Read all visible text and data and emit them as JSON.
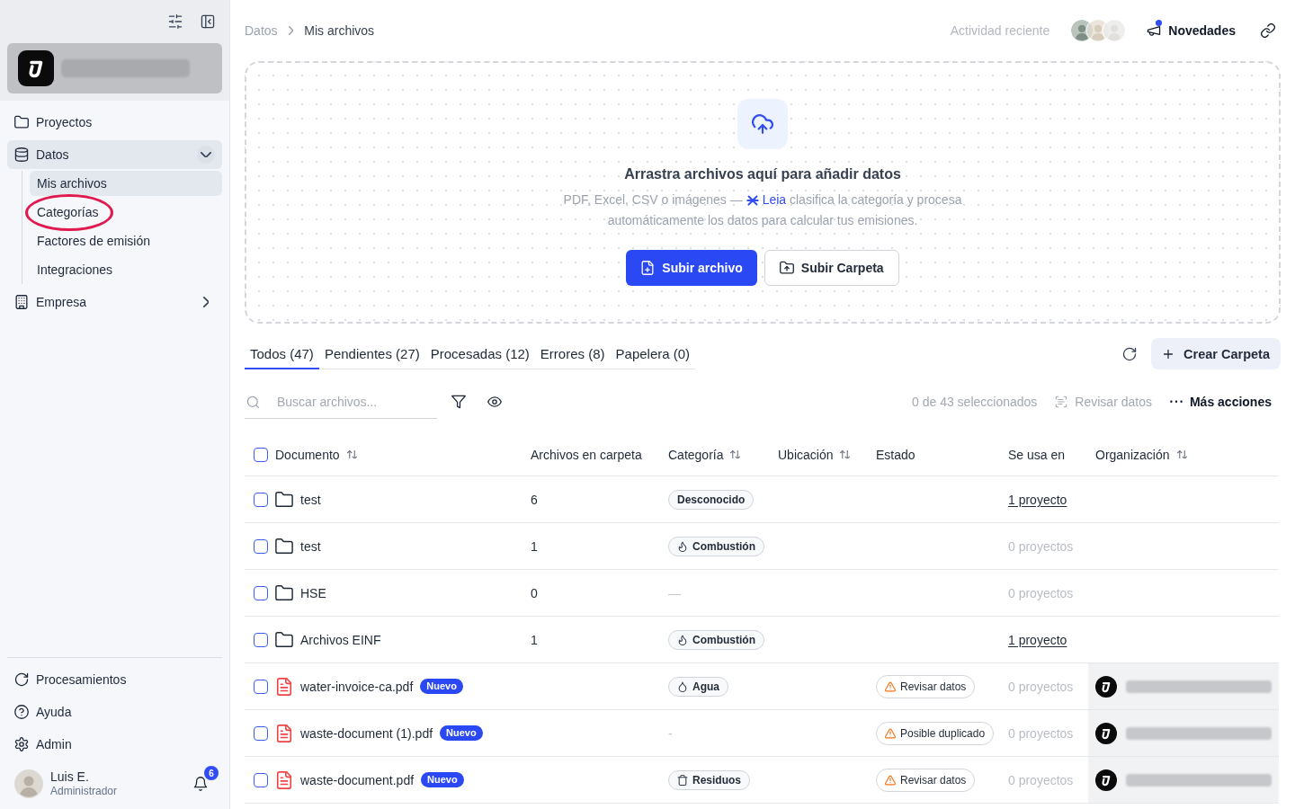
{
  "sidebar": {
    "nav": [
      {
        "label": "Proyectos",
        "kind": "link",
        "selected": false
      },
      {
        "label": "Datos",
        "kind": "group",
        "selected": true,
        "expanded": true,
        "children": [
          {
            "label": "Mis archivos",
            "selected": true,
            "circled": false
          },
          {
            "label": "Categorías",
            "selected": false,
            "circled": true
          },
          {
            "label": "Factores de emisión",
            "selected": false,
            "circled": false
          },
          {
            "label": "Integraciones",
            "selected": false,
            "circled": false
          }
        ]
      },
      {
        "label": "Empresa",
        "kind": "group",
        "selected": false,
        "expanded": false
      }
    ],
    "footer_nav": [
      {
        "label": "Procesamientos"
      },
      {
        "label": "Ayuda"
      },
      {
        "label": "Admin"
      }
    ],
    "user": {
      "name": "Luis E.",
      "role": "Administrador",
      "notifications": "6"
    }
  },
  "topbar": {
    "breadcrumb": [
      "Datos",
      "Mis archivos"
    ],
    "activity": "Actividad reciente",
    "news": {
      "label": "Novedades",
      "unread": true
    }
  },
  "upload": {
    "title": "Arrastra archivos aquí para añadir datos",
    "description_start": "PDF, Excel, CSV o imágenes —",
    "assistant": "Leia",
    "description_end": "clasifica la categoría y procesa automáticamente los datos para calcular tus emisiones.",
    "buttons": [
      {
        "label": "Subir archivo",
        "primary": true
      },
      {
        "label": "Subir Carpeta",
        "primary": false
      }
    ]
  },
  "tabs": [
    {
      "label": "Todos (47)",
      "selected": true
    },
    {
      "label": "Pendientes (27)",
      "selected": false
    },
    {
      "label": "Procesadas (12)",
      "selected": false
    },
    {
      "label": "Errores (8)",
      "selected": false
    },
    {
      "label": "Papelera (0)",
      "selected": false
    }
  ],
  "create_folder": {
    "label": "Crear Carpeta"
  },
  "toolbar": {
    "search": {
      "placeholder": "Buscar archivos..."
    },
    "selection": "0 de 43 seleccionados",
    "actions": [
      {
        "label": "Revisar datos",
        "disabled": true
      },
      {
        "label": "Más acciones",
        "disabled": false
      }
    ]
  },
  "table": {
    "select_all": {
      "checked": false
    },
    "columns": [
      {
        "label": "Documento",
        "sortable": true
      },
      {
        "label": "Archivos en carpeta",
        "sortable": false
      },
      {
        "label": "Categoría",
        "sortable": true
      },
      {
        "label": "Ubicación",
        "sortable": true
      },
      {
        "label": "Estado",
        "sortable": false
      },
      {
        "label": "Se usa en",
        "sortable": false
      },
      {
        "label": "Organización",
        "sortable": true
      }
    ],
    "rows": [
      {
        "checked": false,
        "kind": "folder",
        "name": "test",
        "files": "6",
        "category": {
          "label": "Desconocido",
          "kind": "plain"
        },
        "used_in": {
          "label": "1 proyecto",
          "linked": true
        },
        "has_organization": false
      },
      {
        "checked": false,
        "kind": "folder",
        "name": "test",
        "files": "1",
        "category": {
          "label": "Combustión",
          "kind": "combustion"
        },
        "used_in": {
          "label": "0 proyectos",
          "linked": false
        },
        "has_organization": false
      },
      {
        "checked": false,
        "kind": "folder",
        "name": "HSE",
        "files": "0",
        "category": {
          "label": "—",
          "kind": "none"
        },
        "used_in": {
          "label": "0 proyectos",
          "linked": false
        },
        "has_organization": false
      },
      {
        "checked": false,
        "kind": "folder",
        "name": "Archivos EINF",
        "files": "1",
        "category": {
          "label": "Combustión",
          "kind": "combustion"
        },
        "used_in": {
          "label": "1 proyecto",
          "linked": true
        },
        "has_organization": false
      },
      {
        "checked": false,
        "kind": "pdf",
        "name": "water-invoice-ca.pdf",
        "badge": "Nuevo",
        "category": {
          "label": "Agua",
          "kind": "water"
        },
        "status": {
          "label": "Revisar datos",
          "kind": "warning"
        },
        "used_in": {
          "label": "0 proyectos",
          "linked": false
        },
        "has_organization": true
      },
      {
        "checked": false,
        "kind": "pdf",
        "name": "waste-document (1).pdf",
        "badge": "Nuevo",
        "category": {
          "label": "-",
          "kind": "none"
        },
        "status": {
          "label": "Posible duplicado",
          "kind": "warning"
        },
        "used_in": {
          "label": "0 proyectos",
          "linked": false
        },
        "has_organization": true
      },
      {
        "checked": false,
        "kind": "pdf",
        "name": "waste-document.pdf",
        "badge": "Nuevo",
        "category": {
          "label": "Residuos",
          "kind": "waste"
        },
        "status": {
          "label": "Revisar datos",
          "kind": "warning"
        },
        "used_in": {
          "label": "0 proyectos",
          "linked": false
        },
        "has_organization": true
      }
    ]
  }
}
